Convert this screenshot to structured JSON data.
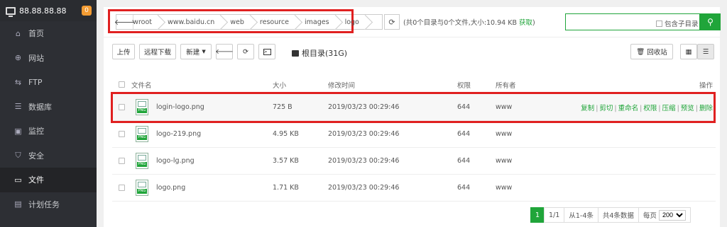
{
  "sidebar": {
    "server": "88.88.88.88",
    "badge": "0",
    "items": [
      {
        "label": "首页",
        "icon": "home-icon",
        "glyph": "⌂"
      },
      {
        "label": "网站",
        "icon": "globe-icon",
        "glyph": "⊕"
      },
      {
        "label": "FTP",
        "icon": "ftp-icon",
        "glyph": "⇆"
      },
      {
        "label": "数据库",
        "icon": "database-icon",
        "glyph": "☰"
      },
      {
        "label": "监控",
        "icon": "monitor-icon",
        "glyph": "▣"
      },
      {
        "label": "安全",
        "icon": "shield-icon",
        "glyph": "⛉"
      },
      {
        "label": "文件",
        "icon": "folder-icon",
        "glyph": "▭"
      },
      {
        "label": "计划任务",
        "icon": "calendar-icon",
        "glyph": "▤"
      }
    ],
    "active_index": 6
  },
  "path": {
    "crumbs": [
      "wwwroot",
      "www.baidu.cn",
      "web",
      "resource",
      "images",
      "logo"
    ]
  },
  "summary": {
    "text": "(共0个目录与0个文件,大小:10.94 KB ",
    "link": "获取",
    "tail": ")"
  },
  "search": {
    "placeholder": "",
    "include_sub": "包含子目录"
  },
  "toolbar": {
    "upload": "上传",
    "remote_download": "远程下载",
    "new": "新建",
    "root": "根目录(31G)",
    "recycle": "回收站"
  },
  "table": {
    "headers": {
      "name": "文件名",
      "size": "大小",
      "time": "修改时间",
      "perm": "权限",
      "owner": "所有者",
      "op": "操作"
    },
    "rows": [
      {
        "name": "login-logo.png",
        "size": "725 B",
        "time": "2019/03/23 00:29:46",
        "perm": "644",
        "owner": "www",
        "badge": "PNG"
      },
      {
        "name": "logo-219.png",
        "size": "4.95 KB",
        "time": "2019/03/23 00:29:46",
        "perm": "644",
        "owner": "www",
        "badge": "PNG"
      },
      {
        "name": "logo-lg.png",
        "size": "3.57 KB",
        "time": "2019/03/23 00:29:46",
        "perm": "644",
        "owner": "www",
        "badge": "PNG"
      },
      {
        "name": "logo.png",
        "size": "1.71 KB",
        "time": "2019/03/23 00:29:46",
        "perm": "644",
        "owner": "www",
        "badge": "PNG"
      }
    ],
    "ops": [
      "复制",
      "剪切",
      "重命名",
      "权限",
      "压缩",
      "预览",
      "删除"
    ]
  },
  "pager": {
    "current": "1",
    "pages": "1/1",
    "range": "从1-4条",
    "total": "共4条数据",
    "per_page_label": "每页",
    "per_page": "200"
  },
  "colors": {
    "accent": "#20a53a",
    "highlight": "#e02020",
    "sidebar_bg": "#2d2f34"
  }
}
